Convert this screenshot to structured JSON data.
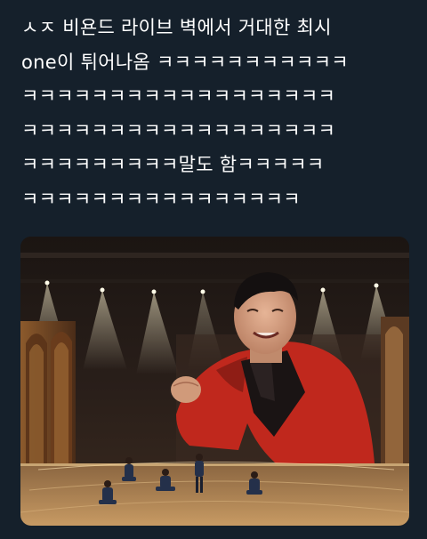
{
  "tweet": {
    "text_lines": [
      "ㅅㅈ 비욘드 라이브 벽에서 거대한 최시",
      "one이 튀어나옴 ㅋㅋㅋㅋㅋㅋㅋㅋㅋㅋㅋ",
      "ㅋㅋㅋㅋㅋㅋㅋㅋㅋㅋㅋㅋㅋㅋㅋㅋㅋㅋ",
      "ㅋㅋㅋㅋㅋㅋㅋㅋㅋㅋㅋㅋㅋㅋㅋㅋㅋㅋ",
      "ㅋㅋㅋㅋㅋㅋㅋㅋㅋ말도 함ㅋㅋㅋㅋㅋ",
      "ㅋㅋㅋㅋㅋㅋㅋㅋㅋㅋㅋㅋㅋㅋㅋㅋ"
    ],
    "media": {
      "icon": "concert-stage-photo"
    }
  },
  "colors": {
    "background": "#15202b",
    "text": "#ffffff",
    "jacket": "#c0281d",
    "stage_light": "#fff6d8"
  }
}
